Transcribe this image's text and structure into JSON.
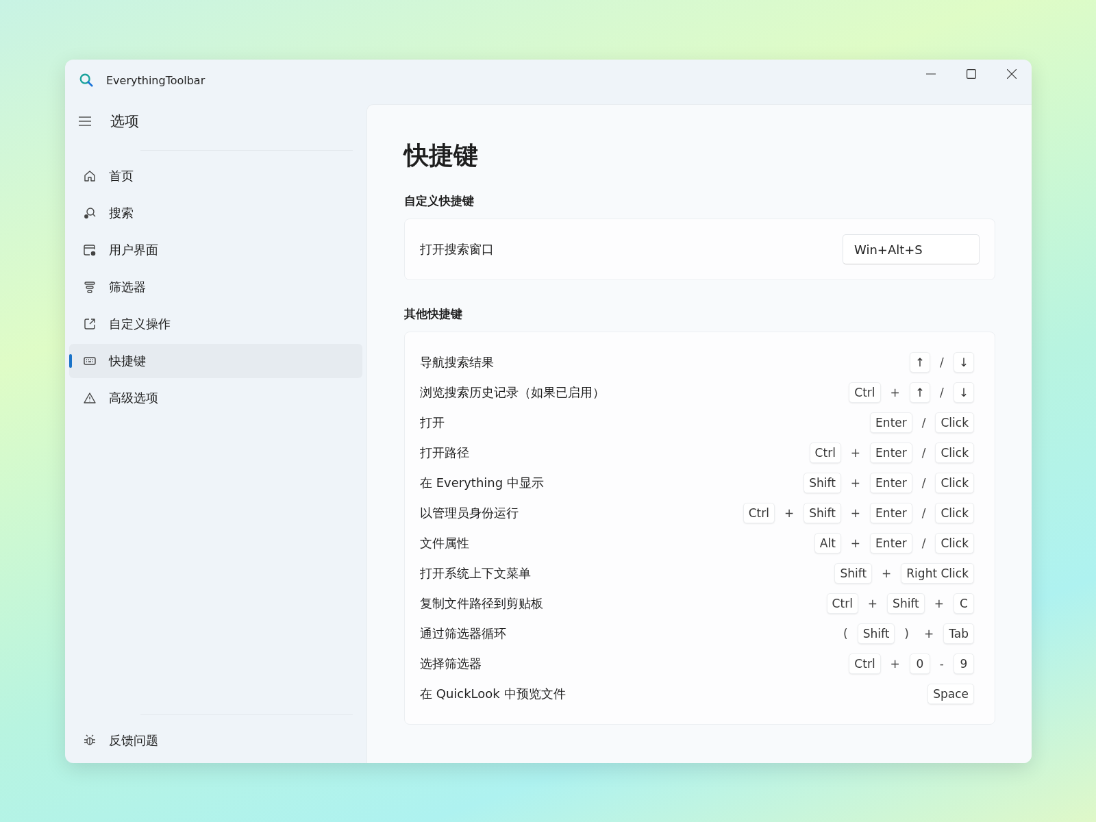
{
  "window": {
    "title": "EverythingToolbar"
  },
  "sidebar": {
    "header": "选项",
    "items": [
      {
        "label": "首页",
        "selected": false
      },
      {
        "label": "搜索",
        "selected": false
      },
      {
        "label": "用户界面",
        "selected": false
      },
      {
        "label": "筛选器",
        "selected": false
      },
      {
        "label": "自定义操作",
        "selected": false
      },
      {
        "label": "快捷键",
        "selected": true
      },
      {
        "label": "高级选项",
        "selected": false
      }
    ],
    "footer_item": {
      "label": "反馈问题"
    }
  },
  "page": {
    "title": "快捷键",
    "custom_section": {
      "heading": "自定义快捷键",
      "rows": [
        {
          "label": "打开搜索窗口",
          "value": "Win+Alt+S"
        }
      ]
    },
    "other_section": {
      "heading": "其他快捷键",
      "rows": [
        {
          "label": "导航搜索结果",
          "keys": [
            {
              "kind": "key",
              "text": "↑"
            },
            {
              "kind": "sep",
              "text": "/"
            },
            {
              "kind": "key",
              "text": "↓"
            }
          ]
        },
        {
          "label": "浏览搜索历史记录（如果已启用）",
          "keys": [
            {
              "kind": "key",
              "text": "Ctrl"
            },
            {
              "kind": "sep",
              "text": "+"
            },
            {
              "kind": "key",
              "text": "↑"
            },
            {
              "kind": "sep",
              "text": "/"
            },
            {
              "kind": "key",
              "text": "↓"
            }
          ]
        },
        {
          "label": "打开",
          "keys": [
            {
              "kind": "key",
              "text": "Enter"
            },
            {
              "kind": "sep",
              "text": "/"
            },
            {
              "kind": "key",
              "text": "Click"
            }
          ]
        },
        {
          "label": "打开路径",
          "keys": [
            {
              "kind": "key",
              "text": "Ctrl"
            },
            {
              "kind": "sep",
              "text": "+"
            },
            {
              "kind": "key",
              "text": "Enter"
            },
            {
              "kind": "sep",
              "text": "/"
            },
            {
              "kind": "key",
              "text": "Click"
            }
          ]
        },
        {
          "label": "在 Everything 中显示",
          "keys": [
            {
              "kind": "key",
              "text": "Shift"
            },
            {
              "kind": "sep",
              "text": "+"
            },
            {
              "kind": "key",
              "text": "Enter"
            },
            {
              "kind": "sep",
              "text": "/"
            },
            {
              "kind": "key",
              "text": "Click"
            }
          ]
        },
        {
          "label": "以管理员身份运行",
          "keys": [
            {
              "kind": "key",
              "text": "Ctrl"
            },
            {
              "kind": "sep",
              "text": "+"
            },
            {
              "kind": "key",
              "text": "Shift"
            },
            {
              "kind": "sep",
              "text": "+"
            },
            {
              "kind": "key",
              "text": "Enter"
            },
            {
              "kind": "sep",
              "text": "/"
            },
            {
              "kind": "key",
              "text": "Click"
            }
          ]
        },
        {
          "label": "文件属性",
          "keys": [
            {
              "kind": "key",
              "text": "Alt"
            },
            {
              "kind": "sep",
              "text": "+"
            },
            {
              "kind": "key",
              "text": "Enter"
            },
            {
              "kind": "sep",
              "text": "/"
            },
            {
              "kind": "key",
              "text": "Click"
            }
          ]
        },
        {
          "label": "打开系统上下文菜单",
          "keys": [
            {
              "kind": "key",
              "text": "Shift"
            },
            {
              "kind": "sep",
              "text": "+"
            },
            {
              "kind": "key",
              "text": "Right Click"
            }
          ]
        },
        {
          "label": "复制文件路径到剪贴板",
          "keys": [
            {
              "kind": "key",
              "text": "Ctrl"
            },
            {
              "kind": "sep",
              "text": "+"
            },
            {
              "kind": "key",
              "text": "Shift"
            },
            {
              "kind": "sep",
              "text": "+"
            },
            {
              "kind": "key",
              "text": "C"
            }
          ]
        },
        {
          "label": "通过筛选器循环",
          "keys": [
            {
              "kind": "sep",
              "text": "("
            },
            {
              "kind": "key",
              "text": "Shift"
            },
            {
              "kind": "sep",
              "text": ")"
            },
            {
              "kind": "sep",
              "text": "+"
            },
            {
              "kind": "key",
              "text": "Tab"
            }
          ]
        },
        {
          "label": "选择筛选器",
          "keys": [
            {
              "kind": "key",
              "text": "Ctrl"
            },
            {
              "kind": "sep",
              "text": "+"
            },
            {
              "kind": "key",
              "text": "0"
            },
            {
              "kind": "sep",
              "text": "-"
            },
            {
              "kind": "key",
              "text": "9"
            }
          ]
        },
        {
          "label": "在 QuickLook 中预览文件",
          "keys": [
            {
              "kind": "key",
              "text": "Space"
            }
          ]
        }
      ]
    }
  }
}
